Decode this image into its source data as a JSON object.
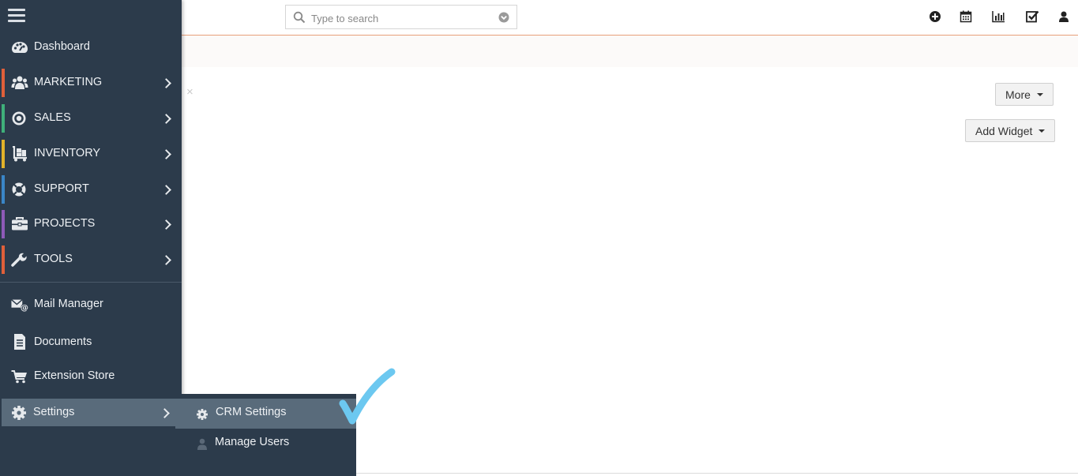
{
  "search": {
    "placeholder": "Type to search"
  },
  "toolbar": {
    "more_label": "More",
    "add_widget_label": "Add Widget",
    "close_glyph": "×"
  },
  "sidebar": {
    "items": [
      {
        "label": "Dashboard",
        "icon": "palette-icon",
        "has_arrow": false
      },
      {
        "label": "MARKETING",
        "icon": "users-icon",
        "color": "#e0603a",
        "has_arrow": true
      },
      {
        "label": "SALES",
        "icon": "target-icon",
        "color": "#3fb07a",
        "has_arrow": true
      },
      {
        "label": "INVENTORY",
        "icon": "dolly-icon",
        "color": "#e2b22a",
        "has_arrow": true
      },
      {
        "label": "SUPPORT",
        "icon": "lifering-icon",
        "color": "#3a86c8",
        "has_arrow": true
      },
      {
        "label": "PROJECTS",
        "icon": "briefcase-icon",
        "color": "#8e5ab8",
        "has_arrow": true
      },
      {
        "label": "TOOLS",
        "icon": "wrench-icon",
        "color": "#e0603a",
        "has_arrow": true
      }
    ],
    "secondary": [
      {
        "label": "Mail Manager",
        "icon": "mail-at-icon"
      },
      {
        "label": "Documents",
        "icon": "document-icon"
      },
      {
        "label": "Extension Store",
        "icon": "cart-icon"
      },
      {
        "label": "Settings",
        "icon": "gear-icon",
        "active": true
      }
    ]
  },
  "submenu": {
    "items": [
      {
        "label": "CRM Settings",
        "icon": "gear-icon",
        "active": true
      },
      {
        "label": "Manage Users",
        "icon": "user-icon"
      }
    ]
  },
  "colors": {
    "sidebar_bg": "#2c3b4b",
    "active_bg": "#596b7b",
    "topbar_border": "#e8a07a",
    "checkmark": "#6cc8f0"
  }
}
